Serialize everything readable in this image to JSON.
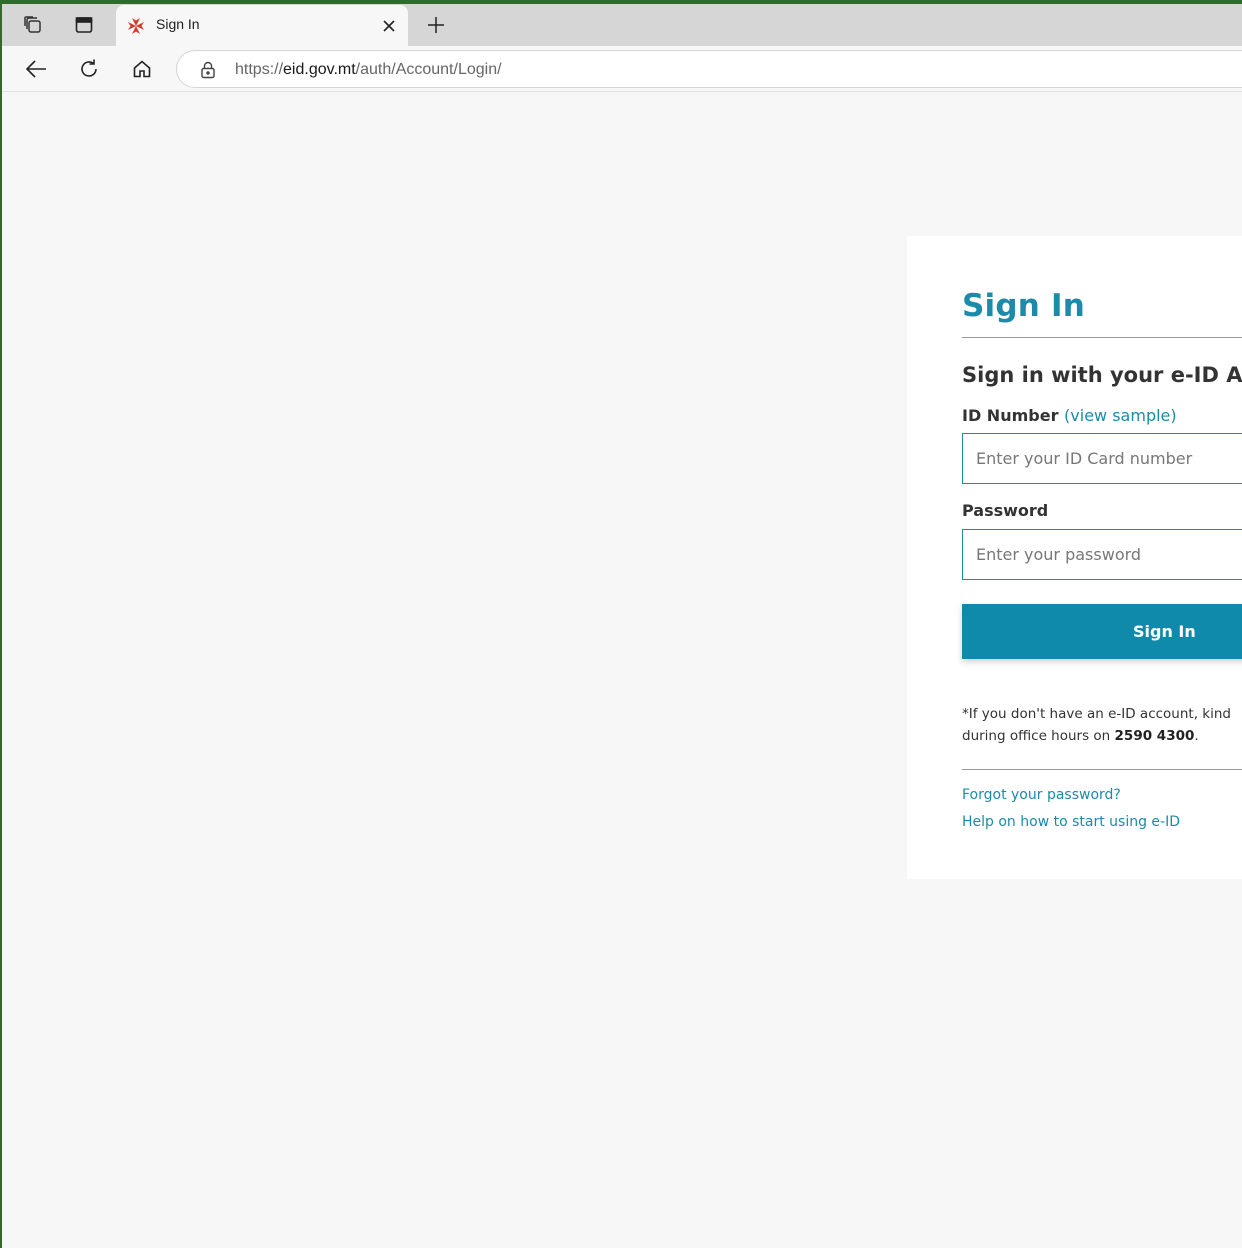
{
  "browser": {
    "tab": {
      "title": "Sign In",
      "favicon": "maltese-cross-icon"
    },
    "address": {
      "scheme": "https://",
      "host": "eid.gov.mt",
      "path": "/auth/Account/Login/"
    },
    "icons": [
      "workspaces-icon",
      "vertical-tabs-icon",
      "close-icon",
      "plus-icon",
      "back-arrow-icon",
      "refresh-icon",
      "home-icon",
      "lock-icon"
    ]
  },
  "login": {
    "title": "Sign In",
    "subtitle": "Sign in with your e-ID Acc",
    "id_label": "ID Number",
    "paren_open": "(",
    "view_sample": "view sample",
    "paren_close": ")",
    "id_placeholder": "Enter your ID Card number",
    "password_label": "Password",
    "password_placeholder": "Enter your password",
    "submit_label": "Sign In",
    "notice_line1": "*If you don't have an e-ID account, kind",
    "notice_line2_prefix": "during office hours on ",
    "notice_phone": "2590 4300",
    "notice_line2_suffix": ".",
    "forgot_link": "Forgot your password?",
    "help_link": "Help on how to start using e-ID"
  },
  "colors": {
    "accent": "#1b8ba9",
    "button": "#0f8aaa",
    "page_background": "#f7f7f7"
  }
}
